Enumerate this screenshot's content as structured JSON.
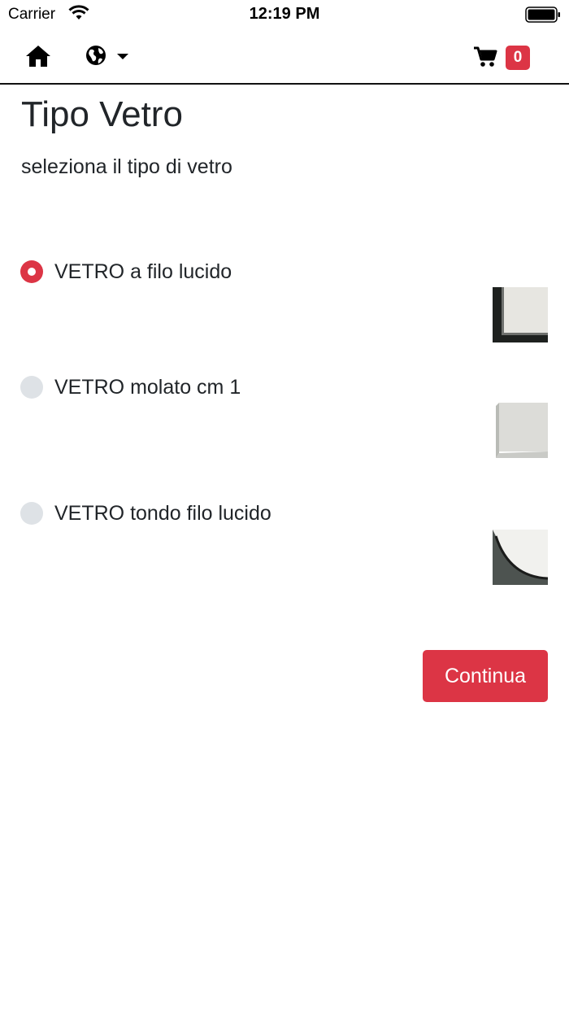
{
  "status_bar": {
    "carrier": "Carrier",
    "time": "12:19 PM"
  },
  "navbar": {
    "home_icon": "home-icon",
    "language_icon": "globe-icon",
    "cart_icon": "shopping-cart-icon",
    "cart_count": "0",
    "badge_color": "#dc3545"
  },
  "page": {
    "title": "Tipo Vetro",
    "subtitle": "seleziona il tipo di vetro"
  },
  "options": [
    {
      "label": "VETRO a filo lucido",
      "selected": true
    },
    {
      "label": "VETRO molato cm 1",
      "selected": false
    },
    {
      "label": "VETRO tondo filo lucido",
      "selected": false
    }
  ],
  "actions": {
    "continue_label": "Continua",
    "accent_color": "#dc3545"
  }
}
